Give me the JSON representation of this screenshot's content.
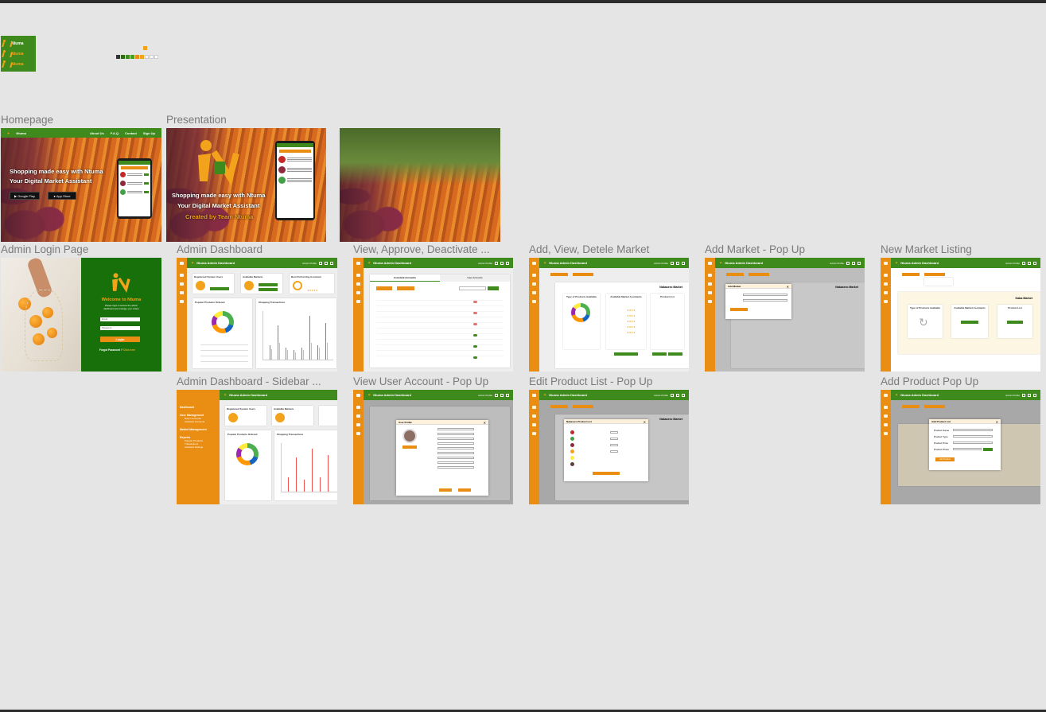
{
  "brand": {
    "name": "Ntuma",
    "logo_variants": [
      "Ntuma",
      "Ntuma",
      "Ntuma"
    ],
    "colors": {
      "green": "#3e8a1d",
      "dark_green": "#177009",
      "orange": "#ea8d13",
      "yellow": "#f2a31b",
      "dark": "#333333",
      "light": "#ffffff"
    },
    "swatches": [
      "#333333",
      "#2f6b14",
      "#3e8a1d",
      "#ea8d13",
      "#f2a31b",
      "#f5f5f5",
      "#ffffff"
    ]
  },
  "frames": {
    "homepage": {
      "label": "Homepage",
      "nav": [
        "About Us",
        "F.A.Q",
        "Contact",
        "Sign Up"
      ],
      "brand": "Ntuma",
      "headline_1": "Shopping made easy with Ntuma",
      "headline_2": "Your Digital Market Assistant",
      "google_play": "Google Play",
      "app_store": "App Store"
    },
    "presentation": {
      "label": "Presentation",
      "headline_1": "Shopping made easy with Ntuma",
      "headline_2": "Your Digital Market Assistant",
      "credit": "Created by Team Ntuma"
    },
    "admin_login": {
      "label": "Admin Login Page",
      "title": "Welcome to Ntuma",
      "subtitle": "Please login to access the admin dashboard and manage your orders",
      "email_placeholder": "Email",
      "password_placeholder": "Password",
      "login_button": "Login",
      "forgot": "Forgot Password ?",
      "click_here": "Click here"
    },
    "admin_dashboard": {
      "label": "Admin Dashboard",
      "title": "Ntuma Admin Dashboard",
      "profile": "Admin Profile",
      "card_1": "Registered System Users",
      "card_2": "Available Markets",
      "card_3": "Best Performing Assistant",
      "chart_1": "Popular Products Ordered",
      "chart_2": "Shopping Transactions"
    },
    "view_approve": {
      "label": "View, Approve, Deactivate ...",
      "tab_1": "Assistant Accounts",
      "tab_2": "User Accounts"
    },
    "add_view_delete_market": {
      "label": "Add, View, Detele Market",
      "market": "Nakasero Market",
      "col_1": "Type of Products Available",
      "col_2": "Available Market Assistants",
      "col_3": "Product List"
    },
    "add_market_popup": {
      "label": "Add Market - Pop Up",
      "modal_title": "Add Market",
      "market": "Nakasero Market"
    },
    "new_market_listing": {
      "label": "New Market Listing",
      "market": "Gaba Market",
      "col_1": "Type of Products Available",
      "col_2": "Available Market Assistants",
      "col_3": "Product List"
    },
    "sidebar": {
      "label": "Admin Dashboard - Sidebar ...",
      "items": [
        "Dashboard",
        "User Management",
        "Buyer Accounts",
        "Assistant Accounts",
        "Market Management",
        "Reports",
        "Popular Products",
        "Transactions",
        "Assistant Ratings"
      ]
    },
    "view_user_popup": {
      "label": "View User Account - Pop Up",
      "modal_title": "User Profile"
    },
    "edit_product_popup": {
      "label": "Edit Product List - Pop Up",
      "modal_title": "Nakasero Product List"
    },
    "add_product_popup": {
      "label": "Add Product Pop Up",
      "modal_title": "Add Product List",
      "fields": [
        "Product Name",
        "Product Type",
        "Product Price",
        "Product Photo"
      ],
      "button": "Add Product"
    }
  }
}
